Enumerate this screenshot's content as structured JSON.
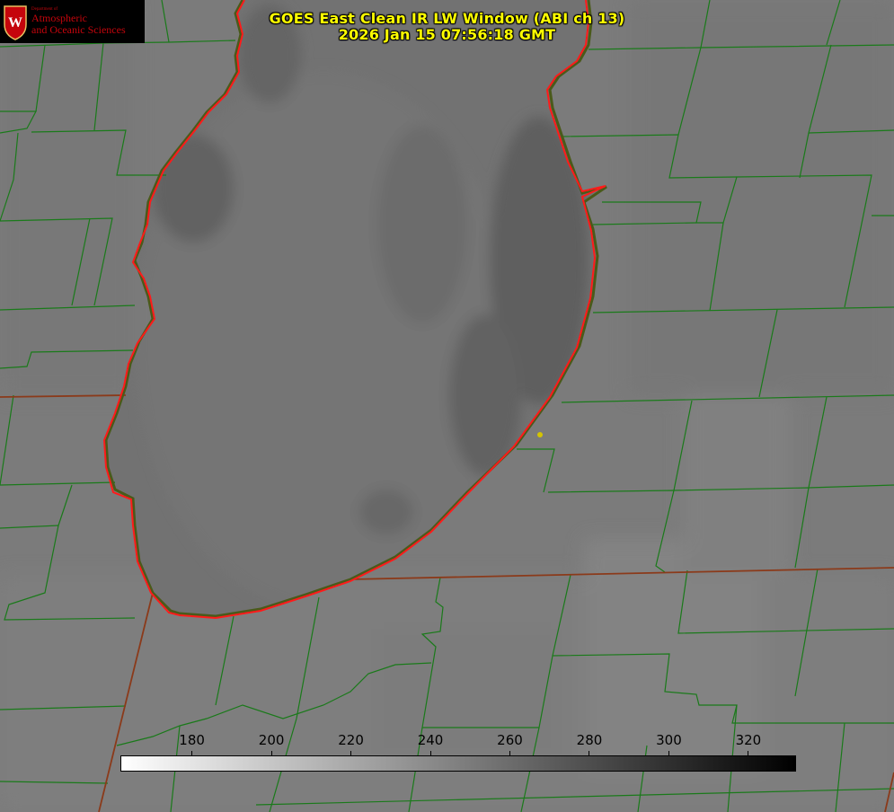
{
  "title_line1": "GOES East Clean IR LW Window (ABI ch 13)",
  "title_line2": "2026 Jan 15 07:56:18 GMT",
  "logo": {
    "department": "Department of",
    "line1": "Atmospheric",
    "line2": "and Oceanic Sciences",
    "emblem_letter": "W"
  },
  "colors": {
    "title": "#ffff00",
    "county_lines": "#1a7a1a",
    "state_lines": "#8b3a1a",
    "coastline": "#ff1a1a",
    "marker": "#d4c400",
    "logo_red": "#c5050c"
  },
  "colorbar": {
    "ticks": [
      "180",
      "200",
      "220",
      "240",
      "260",
      "280",
      "300",
      "320"
    ],
    "min": 162,
    "max": 332,
    "gradient": [
      "#ffffff",
      "#000000"
    ]
  }
}
